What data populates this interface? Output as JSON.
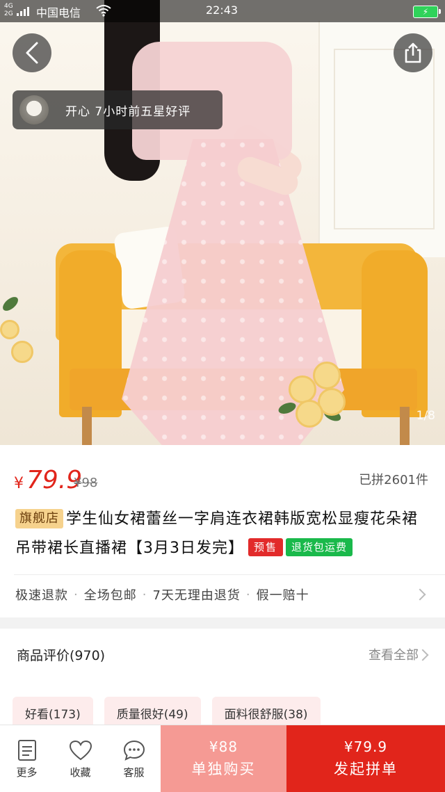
{
  "status_bar": {
    "network": "4G 2G",
    "carrier": "中国电信",
    "time": "22:43",
    "battery_icon": "charging-battery-icon"
  },
  "gallery": {
    "counter": "1/8",
    "review_toast": {
      "text": "开心 7小时前五星好评"
    },
    "back_icon": "chevron-left-icon",
    "share_icon": "share-icon"
  },
  "product": {
    "currency": "¥",
    "price": "79.9",
    "original_price": "¥98",
    "sold": "已拼2601件",
    "store_badge": "旗舰店",
    "title": "学生仙女裙蕾丝一字肩连衣裙韩版宽松显瘦花朵裙吊带裙长直播裙【3月3日发完】",
    "tag_presale": "预售",
    "tag_return": "退货包运费",
    "services": [
      "极速退款",
      "全场包邮",
      "7天无理由退货",
      "假一赔十"
    ]
  },
  "reviews": {
    "title": "商品评价(970)",
    "see_all": "查看全部",
    "tags": [
      "好看(173)",
      "质量很好(49)",
      "面料很舒服(38)"
    ]
  },
  "bottom_bar": {
    "more": "更多",
    "favorite": "收藏",
    "service": "客服",
    "single_price": "¥88",
    "single_label": "单独购买",
    "group_price": "¥79.9",
    "group_label": "发起拼单"
  },
  "colors": {
    "accent_red": "#e1251b",
    "single_buy_pink": "#f59a94",
    "presale_red": "#e22b2b",
    "return_green": "#1ab94b",
    "store_badge_gold": "#f6d28d"
  }
}
